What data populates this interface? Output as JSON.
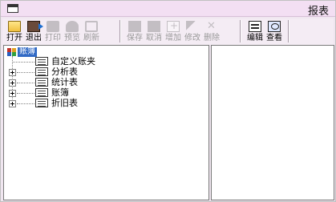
{
  "window": {
    "title": "报表"
  },
  "toolbar": {
    "buttons": [
      {
        "id": "open",
        "label": "打开",
        "icon": "folder-icon",
        "enabled": true
      },
      {
        "id": "exit",
        "label": "退出",
        "icon": "exit-icon",
        "enabled": true
      },
      {
        "id": "print",
        "label": "打印",
        "icon": "print-icon",
        "enabled": false
      },
      {
        "id": "preview",
        "label": "预览",
        "icon": "preview-icon",
        "enabled": false
      },
      {
        "id": "refresh",
        "label": "刷新",
        "icon": "refresh-icon",
        "enabled": false
      },
      {
        "id": "save",
        "label": "保存",
        "icon": "save-icon",
        "enabled": false
      },
      {
        "id": "cancel",
        "label": "取消",
        "icon": "cancel-icon",
        "enabled": false
      },
      {
        "id": "add",
        "label": "增加",
        "icon": "add-icon",
        "enabled": false
      },
      {
        "id": "edit",
        "label": "修改",
        "icon": "edit-icon",
        "enabled": false
      },
      {
        "id": "delete",
        "label": "删除",
        "icon": "delete-icon",
        "enabled": false
      },
      {
        "id": "editor",
        "label": "编辑",
        "icon": "editor-icon",
        "enabled": true
      },
      {
        "id": "view",
        "label": "查看",
        "icon": "view-icon",
        "enabled": true
      }
    ]
  },
  "tree": {
    "root": {
      "label": "账簿",
      "selected": true
    },
    "children": [
      {
        "label": "自定义账夹",
        "expandable": false
      },
      {
        "label": "分析表",
        "expandable": true
      },
      {
        "label": "统计表",
        "expandable": true
      },
      {
        "label": "账簿",
        "expandable": true
      },
      {
        "label": "折旧表",
        "expandable": true
      }
    ]
  }
}
